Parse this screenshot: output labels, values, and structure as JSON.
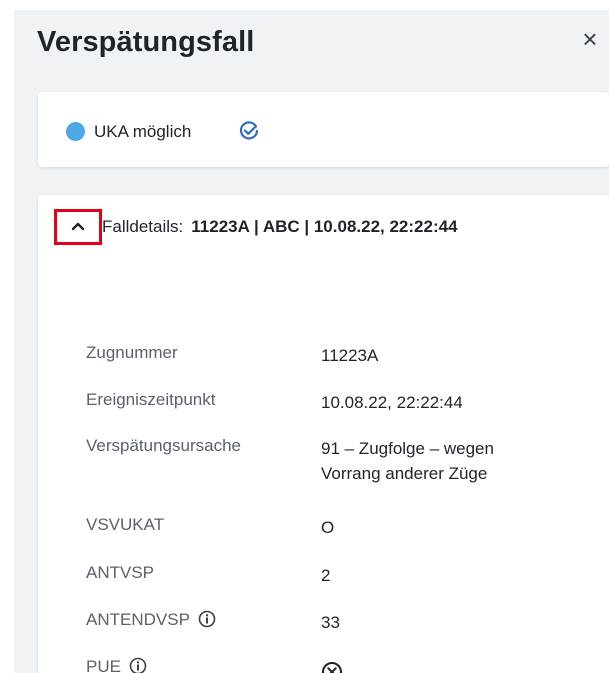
{
  "panel": {
    "title": "Verspätungsfall",
    "close_symbol": "×",
    "close_icon": "close-icon"
  },
  "status": {
    "dot_color": "#4fa8e6",
    "label": "UKA möglich",
    "icon": "check-circle-icon"
  },
  "details": {
    "toggle_icon": "chevron-up-icon",
    "toggle_highlight_color": "#e3001b",
    "label": "Falldetails:",
    "summary": "11223A | ABC | 10.08.22, 22:22:44",
    "rows": [
      {
        "key": "Zugnummer",
        "value": "11223A"
      },
      {
        "key": "Ereigniszeitpunkt",
        "value": "10.08.22, 22:22:44"
      },
      {
        "key": "Verspätungsursache",
        "value_line1": "91 – Zugfolge – wegen",
        "value_line2": "Vorrang anderer Züge"
      },
      {
        "key": "VSVUKAT",
        "value": "O"
      },
      {
        "key": "ANTVSP",
        "value": "2"
      },
      {
        "key": "ANTENDVSP",
        "value": "33",
        "icon": "info-icon"
      },
      {
        "key": "PUE",
        "value_icon": "cross-circle-icon",
        "icon": "info-icon"
      }
    ]
  }
}
